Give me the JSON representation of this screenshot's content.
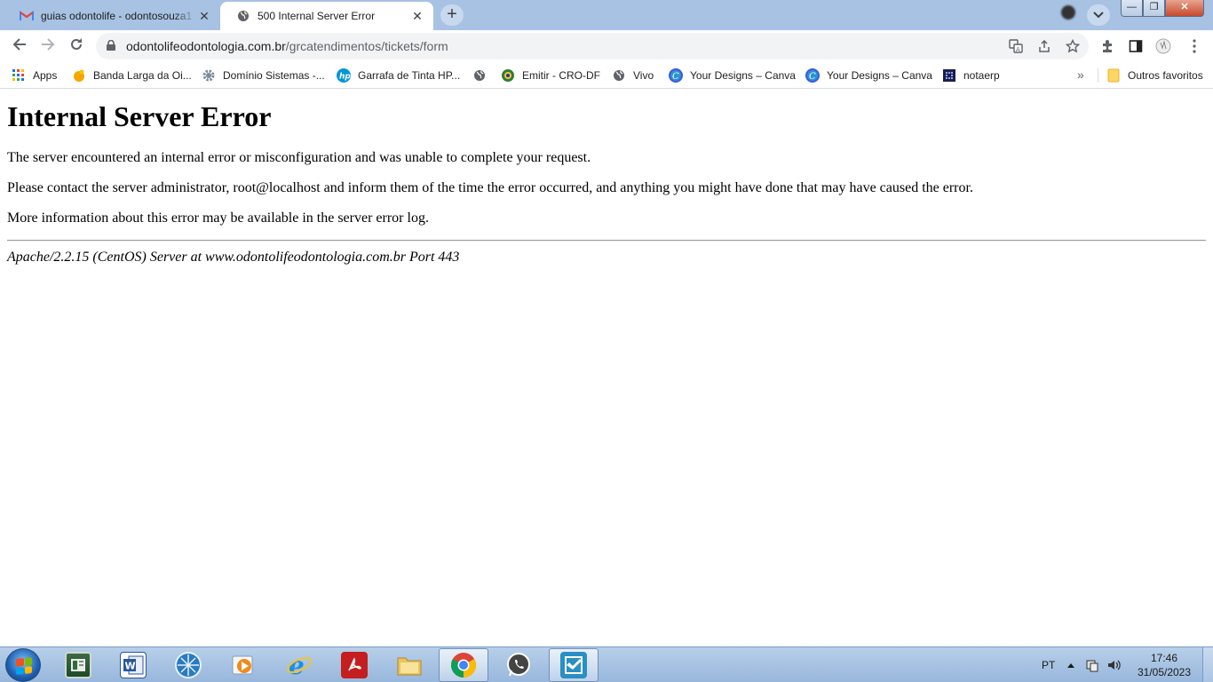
{
  "tabs": [
    {
      "title": "guias odontolife - odontosouza1",
      "close": "✕",
      "favicon": "gmail-icon"
    },
    {
      "title": "500 Internal Server Error",
      "close": "✕",
      "favicon": "globe-icon"
    }
  ],
  "tabstrip": {
    "new_tab": "+",
    "tab_search": "chevron-down-icon"
  },
  "window_controls": {
    "minimize": "—",
    "maximize": "❐",
    "close": "✕"
  },
  "toolbar": {
    "url_host": "odontolifeodontologia.com.br",
    "url_path": "/grcatendimentos/tickets/form"
  },
  "bookmarks": [
    {
      "label": "Apps",
      "icon": "apps-grid-icon"
    },
    {
      "label": "Banda Larga da Oi...",
      "icon": "oi-icon"
    },
    {
      "label": "Domínio Sistemas -...",
      "icon": "gear-icon"
    },
    {
      "label": "Garrafa de Tinta HP...",
      "icon": "hp-icon"
    },
    {
      "label": "",
      "icon": "globe-icon"
    },
    {
      "label": "Emitir - CRO-DF",
      "icon": "cro-icon"
    },
    {
      "label": "Vivo",
      "icon": "globe-icon"
    },
    {
      "label": "Your Designs – Canva",
      "icon": "canva-icon"
    },
    {
      "label": "Your Designs – Canva",
      "icon": "canva-icon"
    },
    {
      "label": "notaerp",
      "icon": "notaerp-icon"
    }
  ],
  "bookmarks_more": "»",
  "other_bookmarks": "Outros favoritos",
  "page": {
    "heading": "Internal Server Error",
    "p1": "The server encountered an internal error or misconfiguration and was unable to complete your request.",
    "p2": "Please contact the server administrator, root@localhost and inform them of the time the error occurred, and anything you might have done that may have caused the error.",
    "p3": "More information about this error may be available in the server error log.",
    "address": "Apache/2.2.15 (CentOS) Server at www.odontolifeodontologia.com.br Port 443"
  },
  "taskbar": {
    "apps": [
      "file-manager-icon",
      "word-icon",
      "network-icon",
      "media-player-icon",
      "internet-explorer-icon",
      "acrobat-icon",
      "folder-icon",
      "chrome-icon",
      "whatsapp-icon",
      "checklist-icon"
    ],
    "language": "PT",
    "time": "17:46",
    "date": "31/05/2023"
  }
}
